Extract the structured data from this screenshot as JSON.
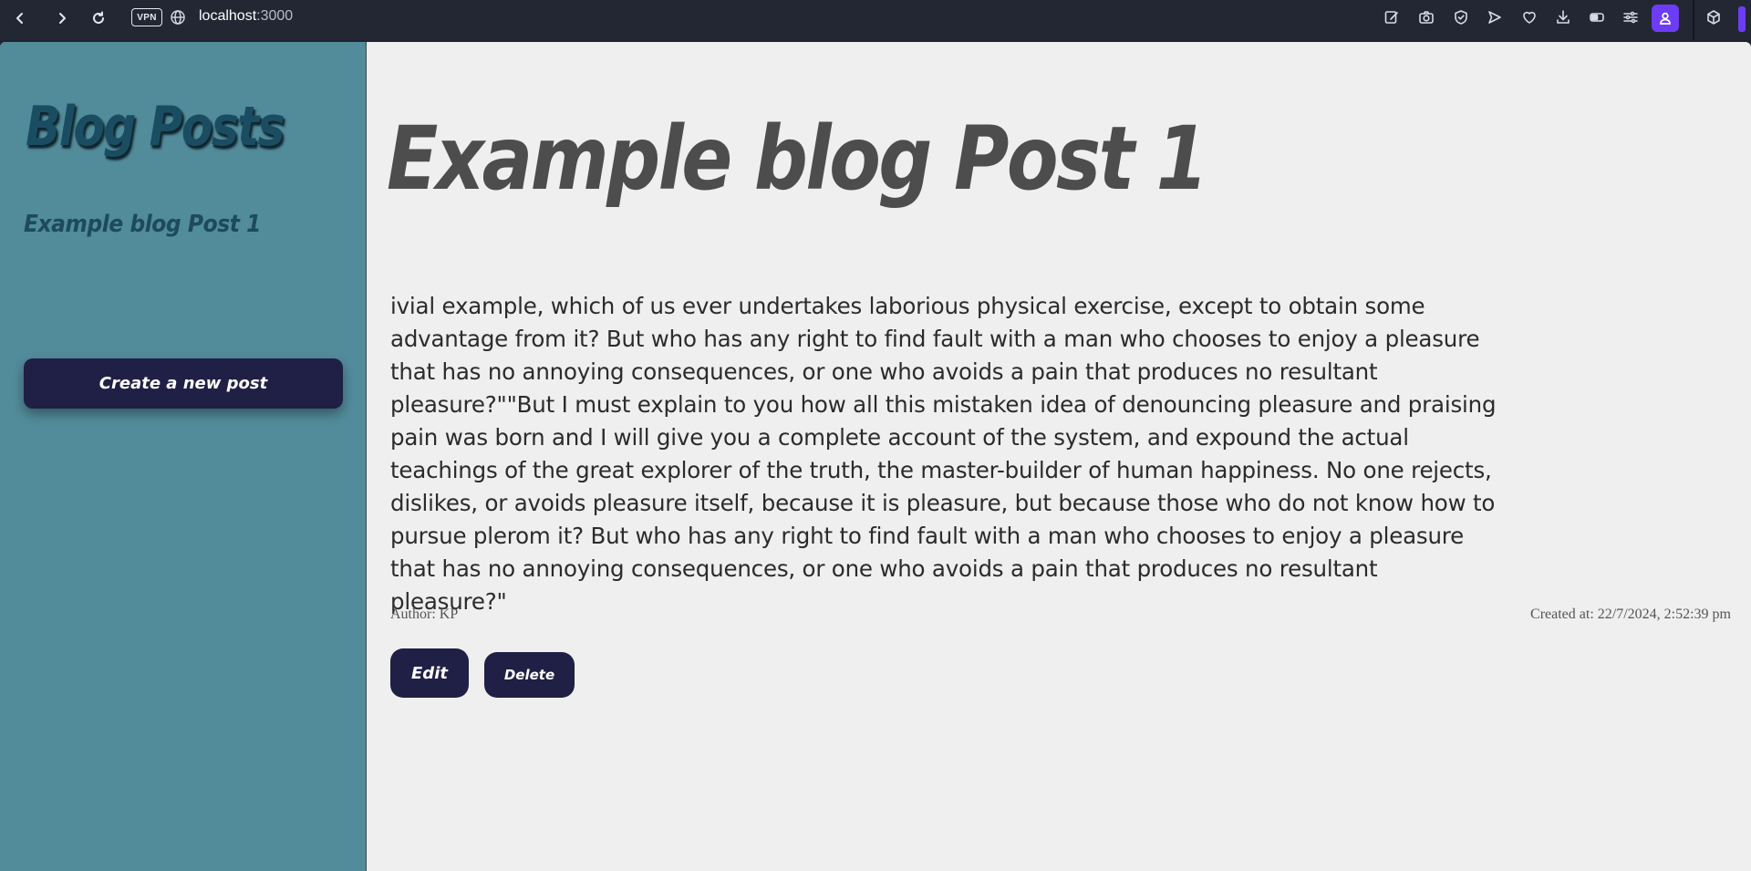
{
  "browser": {
    "url_host": "localhost",
    "url_port": ":3000",
    "vpn_label": "VPN",
    "toolbar_icons": [
      "back-icon",
      "forward-icon",
      "reload-icon",
      "edit-note-icon",
      "camera-icon",
      "shield-icon",
      "send-icon",
      "heart-icon",
      "download-icon",
      "battery-icon",
      "settings-icon",
      "profile-icon",
      "extension-cube-icon"
    ],
    "accent_color": "#6d3cf5"
  },
  "sidebar": {
    "title": "Blog Posts",
    "posts": [
      "Example blog Post 1"
    ],
    "create_button_label": "Create a new post",
    "background_color": "#528b9a"
  },
  "post": {
    "title": "Example blog Post 1",
    "body": "ivial example, which of us ever undertakes laborious physical exercise, except to obtain some advantage from it? But who has any right to find fault with a man who chooses to enjoy a pleasure that has no annoying consequences, or one who avoids a pain that produces no resultant pleasure?\"\"But I must explain to you how all this mistaken idea of denouncing pleasure and praising pain was born and I will give you a complete account of the system, and expound the actual teachings of the great explorer of the truth, the master-builder of human happiness. No one rejects, dislikes, or avoids pleasure itself, because it is pleasure, but because those who do not know how to pursue plerom it? But who has any right to find fault with a man who chooses to enjoy a pleasure that has no annoying consequences, or one who avoids a pain that produces no resultant pleasure?\"",
    "author": "Author: KP",
    "created_at": "Created at: 22/7/2024, 2:52:39 pm",
    "edit_label": "Edit",
    "delete_label": "Delete",
    "button_color": "#201f45"
  }
}
